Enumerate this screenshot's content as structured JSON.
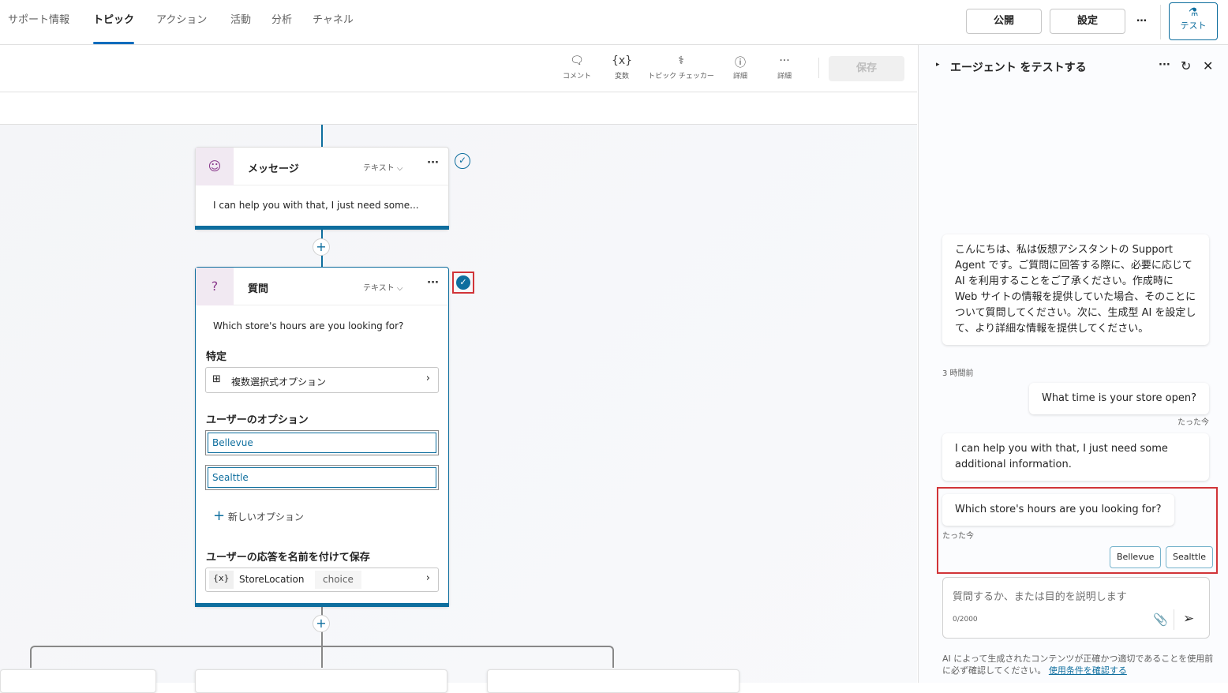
{
  "nav": {
    "tabs": [
      "サポート情報",
      "トピック",
      "アクション",
      "活動",
      "分析",
      "チャネル"
    ],
    "active": 1,
    "publish": "公開",
    "settings": "設定",
    "more": "…",
    "test": "テスト"
  },
  "toolbar": {
    "comment": "コメント",
    "variables": "変数",
    "checker": "トピック チェッカー",
    "details": "詳細",
    "more": "詳細",
    "save": "保存"
  },
  "message_node": {
    "title": "メッセージ",
    "type": "テキスト",
    "text": "I can help you with that, I just need some..."
  },
  "question_node": {
    "title": "質問",
    "type": "テキスト",
    "text": "Which store's hours are you looking for?",
    "identify_label": "特定",
    "identify_value": "複数選択式オプション",
    "options_label": "ユーザーのオプション",
    "options": [
      "Bellevue",
      "Sealttle"
    ],
    "new_option": "新しいオプション",
    "save_label": "ユーザーの応答を名前を付けて保存",
    "var_icon": "{x}",
    "var_name": "StoreLocation",
    "var_type": "choice"
  },
  "test_panel": {
    "title": "エージェント をテストする",
    "messages": [
      {
        "from": "bot",
        "text": "こんにちは、私は仮想アシスタントの Support Agent です。ご質問に回答する際に、必要に応じて AI を利用することをご了承ください。作成時に Web サイトの情報を提供していた場合、そのことについて質問してください。次に、生成型 AI を設定して、より詳細な情報を提供してください。",
        "time": "3 時間前"
      },
      {
        "from": "user",
        "text": "What time is your store open?",
        "time": "たった今"
      },
      {
        "from": "bot",
        "text": "I can help you with that, I just need some additional information."
      },
      {
        "from": "bot",
        "text": "Which store's hours are you looking for?",
        "time": "たった今"
      }
    ],
    "choices": [
      "Bellevue",
      "Sealttle"
    ],
    "input_placeholder": "質問するか、または目的を説明します",
    "counter": "0/2000",
    "disclaimer": "AI によって生成されたコンテンツが正確かつ適切であることを使用前に必ず確認してください。",
    "terms_link": "使用条件を確認する"
  },
  "colors": {
    "accent": "#0e6e9e",
    "highlight": "#d13438"
  }
}
